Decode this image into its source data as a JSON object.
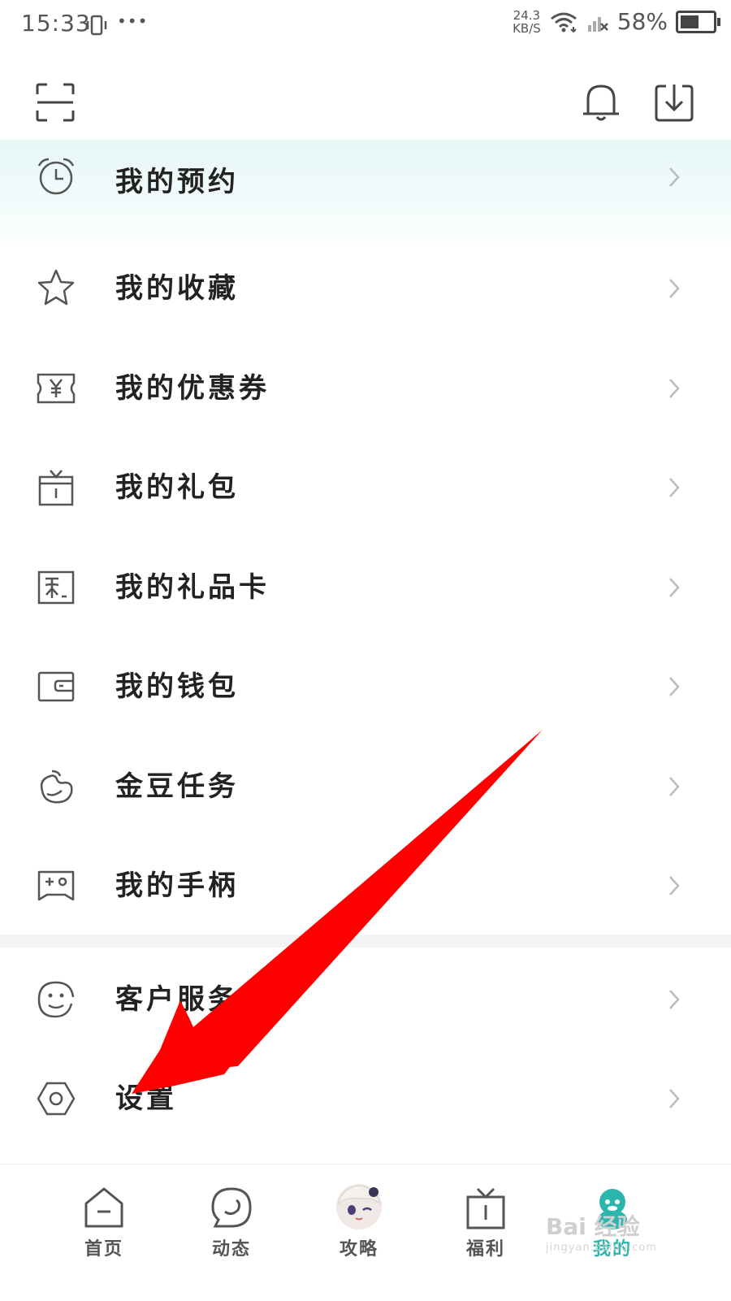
{
  "status_bar": {
    "time": "15:33",
    "more": "•••",
    "net_speed_value": "24.3",
    "net_speed_unit": "KB/S",
    "battery": "58%",
    "battery_level": 0.58
  },
  "menu": {
    "items": [
      {
        "label": "我的预约",
        "icon": "alarm-clock-icon"
      },
      {
        "label": "我的收藏",
        "icon": "star-icon"
      },
      {
        "label": "我的优惠券",
        "icon": "coupon-icon"
      },
      {
        "label": "我的礼包",
        "icon": "gift-box-icon"
      },
      {
        "label": "我的礼品卡",
        "icon": "gift-card-icon"
      },
      {
        "label": "我的钱包",
        "icon": "wallet-icon"
      },
      {
        "label": "金豆任务",
        "icon": "bean-icon"
      },
      {
        "label": "我的手柄",
        "icon": "gamepad-icon"
      },
      {
        "label": "客户服务",
        "icon": "customer-service-icon"
      },
      {
        "label": "设置",
        "icon": "settings-hex-icon"
      }
    ]
  },
  "bottom_nav": {
    "tabs": [
      {
        "label": "首页",
        "icon": "home-icon"
      },
      {
        "label": "动态",
        "icon": "feed-bubble-icon"
      },
      {
        "label": "攻略",
        "icon": "avatar-icon"
      },
      {
        "label": "福利",
        "icon": "gift-icon"
      },
      {
        "label": "我的",
        "icon": "profile-mascot-icon"
      }
    ],
    "active_index": 4
  },
  "watermark": {
    "brand": "Bai 经验",
    "url": "jingyan.baidu.com"
  },
  "colors": {
    "accent": "#2bb6ad",
    "arrow": "#ff0000",
    "icon_stroke": "#555555"
  }
}
